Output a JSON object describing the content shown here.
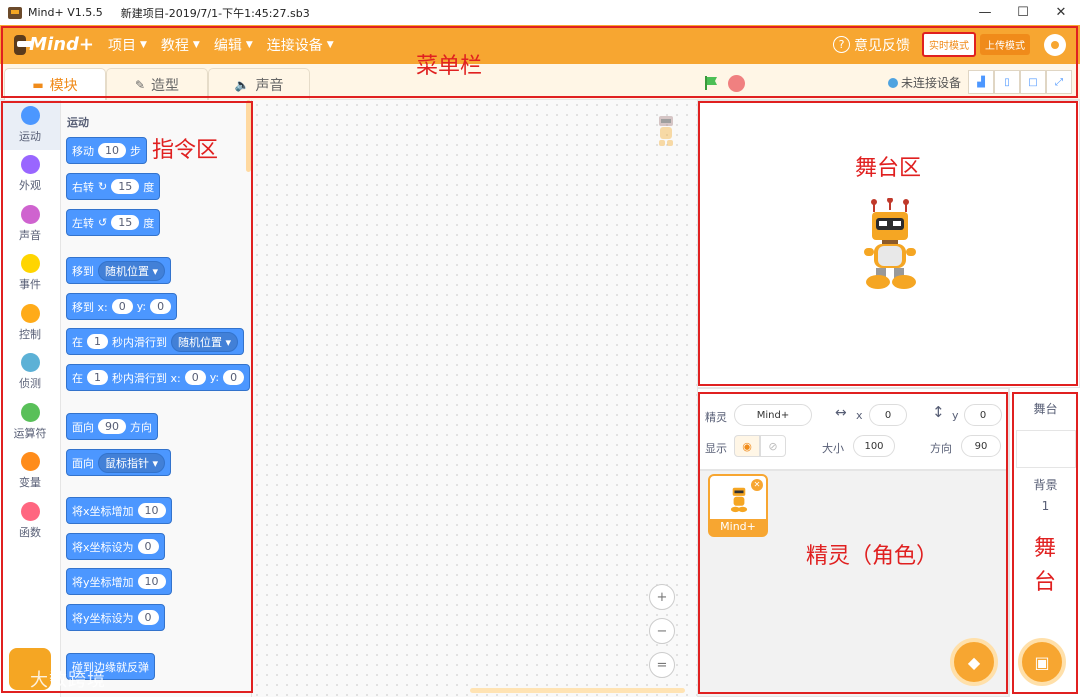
{
  "titlebar": {
    "app": "Mind+ V1.5.5",
    "file": "新建项目-2019/7/1-下午1:45:27.sb3",
    "min": "—",
    "max": "☐",
    "close": "✕"
  },
  "menubar": {
    "logo": "Mind+",
    "items": [
      "项目",
      "教程",
      "编辑",
      "连接设备"
    ],
    "feedback": "意见反馈",
    "mode_realtime": "实时模式",
    "mode_upload": "上传模式"
  },
  "tabs": [
    {
      "label": "模块",
      "icon": "blocks-icon"
    },
    {
      "label": "造型",
      "icon": "brush-icon"
    },
    {
      "label": "声音",
      "icon": "speaker-icon"
    }
  ],
  "device_status": "未连接设备",
  "categories": [
    {
      "label": "运动",
      "color": "#4c97ff"
    },
    {
      "label": "外观",
      "color": "#9966ff"
    },
    {
      "label": "声音",
      "color": "#cf63cf"
    },
    {
      "label": "事件",
      "color": "#ffd500"
    },
    {
      "label": "控制",
      "color": "#ffab19"
    },
    {
      "label": "侦测",
      "color": "#5cb1d6"
    },
    {
      "label": "运算符",
      "color": "#59c059"
    },
    {
      "label": "变量",
      "color": "#ff8c1a"
    },
    {
      "label": "函数",
      "color": "#ff6680"
    }
  ],
  "palette": {
    "title": "运动",
    "blocks": {
      "move": {
        "a": "移动",
        "v": "10",
        "b": "步"
      },
      "turn_right": {
        "a": "右转",
        "icon": "↻",
        "v": "15",
        "b": "度"
      },
      "turn_left": {
        "a": "左转",
        "icon": "↺",
        "v": "15",
        "b": "度"
      },
      "goto": {
        "a": "移到",
        "d": "随机位置"
      },
      "goto_xy": {
        "a": "移到 x:",
        "x": "0",
        "b": "y:",
        "y": "0"
      },
      "glide": {
        "a": "在",
        "v": "1",
        "b": "秒内滑行到",
        "d": "随机位置"
      },
      "glide_xy": {
        "a": "在",
        "v": "1",
        "b": "秒内滑行到 x:",
        "x": "0",
        "c": "y:",
        "y": "0"
      },
      "point": {
        "a": "面向",
        "v": "90",
        "b": "方向"
      },
      "point_to": {
        "a": "面向",
        "d": "鼠标指针"
      },
      "change_x": {
        "a": "将x坐标增加",
        "v": "10"
      },
      "set_x": {
        "a": "将x坐标设为",
        "v": "0"
      },
      "change_y": {
        "a": "将y坐标增加",
        "v": "10"
      },
      "set_y": {
        "a": "将y坐标设为",
        "v": "0"
      },
      "bounce": {
        "a": "碰到边缘就反弹"
      }
    }
  },
  "zoom": {
    "in": "+",
    "out": "−",
    "reset": "="
  },
  "sprite_info": {
    "sprite_label": "精灵",
    "sprite_name": "Mind+",
    "x_label": "x",
    "x": "0",
    "y_label": "y",
    "y": "0",
    "show_label": "显示",
    "size_label": "大小",
    "size": "100",
    "dir_label": "方向",
    "direction": "90"
  },
  "sprite_list": [
    {
      "name": "Mind+"
    }
  ],
  "stage_panel": {
    "title": "舞台",
    "backdrop_label": "背景",
    "backdrop_count": "1"
  },
  "annotations": {
    "menubar": "菜单栏",
    "palette": "指令区",
    "stage": "舞台区",
    "sprite": "精灵（角色）",
    "stage_col": "舞\n台"
  },
  "watermark": "大数跨境"
}
